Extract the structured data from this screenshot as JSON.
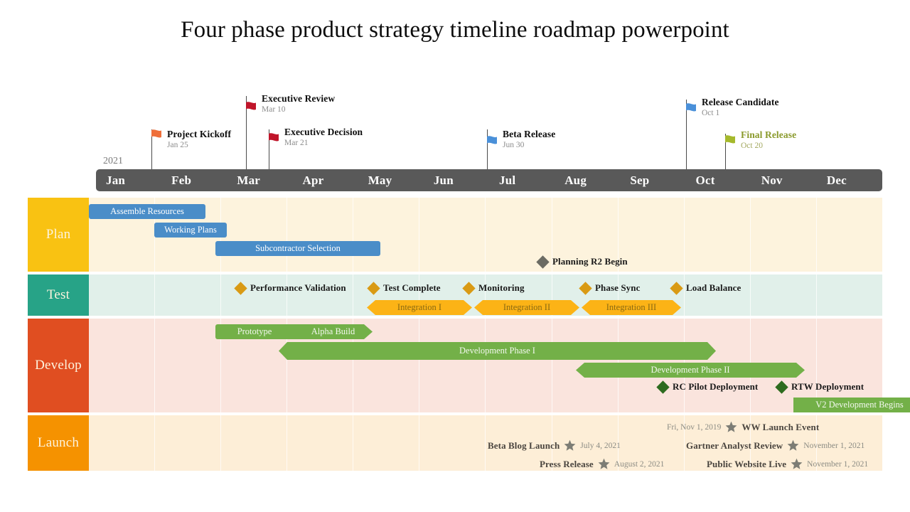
{
  "title": "Four phase product strategy timeline roadmap powerpoint",
  "timeline": {
    "year": "2021",
    "months": [
      "Jan",
      "Feb",
      "Mar",
      "Apr",
      "May",
      "Jun",
      "Jul",
      "Aug",
      "Sep",
      "Oct",
      "Nov",
      "Dec"
    ]
  },
  "flag_milestones": [
    {
      "name": "Project Kickoff",
      "date": "Jan 25",
      "color": "#ef6f3a",
      "icon": "flag-icon"
    },
    {
      "name": "Executive Review",
      "date": "Mar 10",
      "color": "#c0152a",
      "icon": "flag-icon"
    },
    {
      "name": "Executive Decision",
      "date": "Mar 21",
      "color": "#c0152a",
      "icon": "flag-icon"
    },
    {
      "name": "Beta Release",
      "date": "Jun 30",
      "color": "#4a90d9",
      "icon": "flag-icon"
    },
    {
      "name": "Release Candidate",
      "date": "Oct 1",
      "color": "#4a90d9",
      "icon": "flag-icon"
    },
    {
      "name": "Final Release",
      "date": "Oct 20",
      "color": "#a5b92c",
      "icon": "flag-icon"
    }
  ],
  "lanes": [
    {
      "label": "Plan",
      "label_color": "#f9c212",
      "background": "#fdf3dd",
      "tasks": [
        {
          "label": "Assemble Resources"
        },
        {
          "label": "Working Plans"
        },
        {
          "label": "Subcontractor Selection"
        }
      ],
      "milestones": [
        {
          "label": "Planning R2 Begin",
          "marker": "diamond-icon",
          "color": "#6b6b63"
        }
      ]
    },
    {
      "label": "Test",
      "label_color": "#27a387",
      "background": "#e1f0ea",
      "milestones": [
        {
          "label": "Performance Validation",
          "marker": "diamond-icon",
          "color": "#d99a14"
        },
        {
          "label": "Test Complete",
          "marker": "diamond-icon",
          "color": "#d99a14"
        },
        {
          "label": "Monitoring",
          "marker": "diamond-icon",
          "color": "#d99a14"
        },
        {
          "label": "Phase Sync",
          "marker": "diamond-icon",
          "color": "#d99a14"
        },
        {
          "label": "Load Balance",
          "marker": "diamond-icon",
          "color": "#d99a14"
        }
      ],
      "tasks": [
        {
          "label": "Integration I"
        },
        {
          "label": "Integration II"
        },
        {
          "label": "Integration III"
        }
      ]
    },
    {
      "label": "Develop",
      "label_color": "#e04e21",
      "background": "#fae4dd",
      "tasks": [
        {
          "label": "Prototype"
        },
        {
          "label": "Alpha Build"
        },
        {
          "label": "Development Phase I"
        },
        {
          "label": "Development Phase II"
        },
        {
          "label": "V2 Development Begins"
        }
      ],
      "milestones": [
        {
          "label": "RC Pilot Deployment",
          "marker": "diamond-icon",
          "color": "#2d6b1f"
        },
        {
          "label": "RTW Deployment",
          "marker": "diamond-icon",
          "color": "#2d6b1f"
        }
      ]
    },
    {
      "label": "Launch",
      "label_color": "#f59200",
      "background": "#fdeed7",
      "milestones": [
        {
          "label": "Beta Blog Launch",
          "date": "July 4, 2021",
          "marker": "star-icon",
          "order": "label-first"
        },
        {
          "label": "Press Release",
          "date": "August 2, 2021",
          "marker": "star-icon",
          "order": "label-first"
        },
        {
          "label": "WW Launch Event",
          "date": "Fri, Nov 1, 2019",
          "marker": "star-icon",
          "order": "date-first"
        },
        {
          "label": "Gartner Analyst Review",
          "date": "November 1, 2021",
          "marker": "star-icon",
          "order": "label-first"
        },
        {
          "label": "Public Website Live",
          "date": "November 1, 2021",
          "marker": "star-icon",
          "order": "label-first"
        }
      ]
    }
  ]
}
